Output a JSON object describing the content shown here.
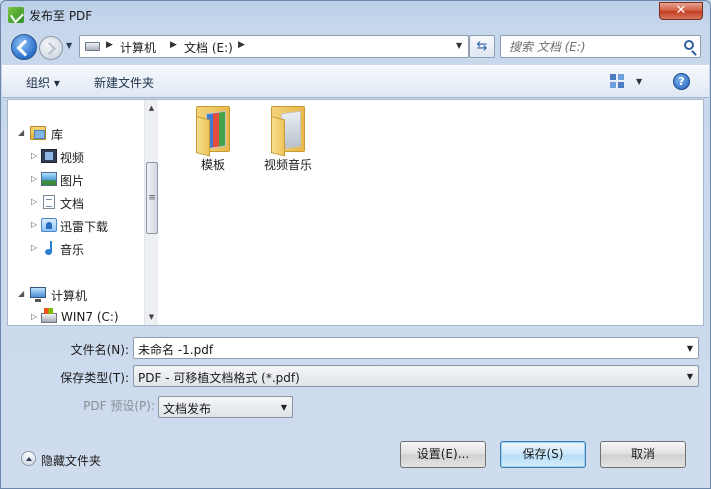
{
  "window": {
    "title": "发布至 PDF",
    "close_symbol": "✕"
  },
  "address": {
    "crumbs": [
      "计算机",
      "文档 (E:)"
    ],
    "search_placeholder": "搜索 文档 (E:)"
  },
  "toolbar": {
    "organize": "组织 ▾",
    "new_folder": "新建文件夹",
    "help": "?"
  },
  "nav_tree": [
    {
      "label": "库",
      "icon": "library-icon",
      "expanded": true
    },
    {
      "label": "视频",
      "icon": "video-icon"
    },
    {
      "label": "图片",
      "icon": "picture-icon"
    },
    {
      "label": "文档",
      "icon": "document-icon"
    },
    {
      "label": "迅雷下载",
      "icon": "thunder-icon"
    },
    {
      "label": "音乐",
      "icon": "music-icon"
    },
    {
      "label": "计算机",
      "icon": "computer-icon",
      "expanded": true
    },
    {
      "label": "WIN7 (C:)",
      "icon": "drive-icon"
    }
  ],
  "files": [
    {
      "label": "模板",
      "icon": "folder-icon"
    },
    {
      "label": "视频音乐",
      "icon": "folder-icon"
    }
  ],
  "form": {
    "filename_label": "文件名(N):",
    "filename_value": "未命名 -1.pdf",
    "type_label": "保存类型(T):",
    "type_value": "PDF - 可移植文档格式 (*.pdf)",
    "preset_label": "PDF 预设(P):",
    "preset_value": "文档发布"
  },
  "footer": {
    "hide_folders": "隐藏文件夹",
    "settings_button": "设置(E)...",
    "save_button": "保存(S)",
    "cancel_button": "取消"
  }
}
